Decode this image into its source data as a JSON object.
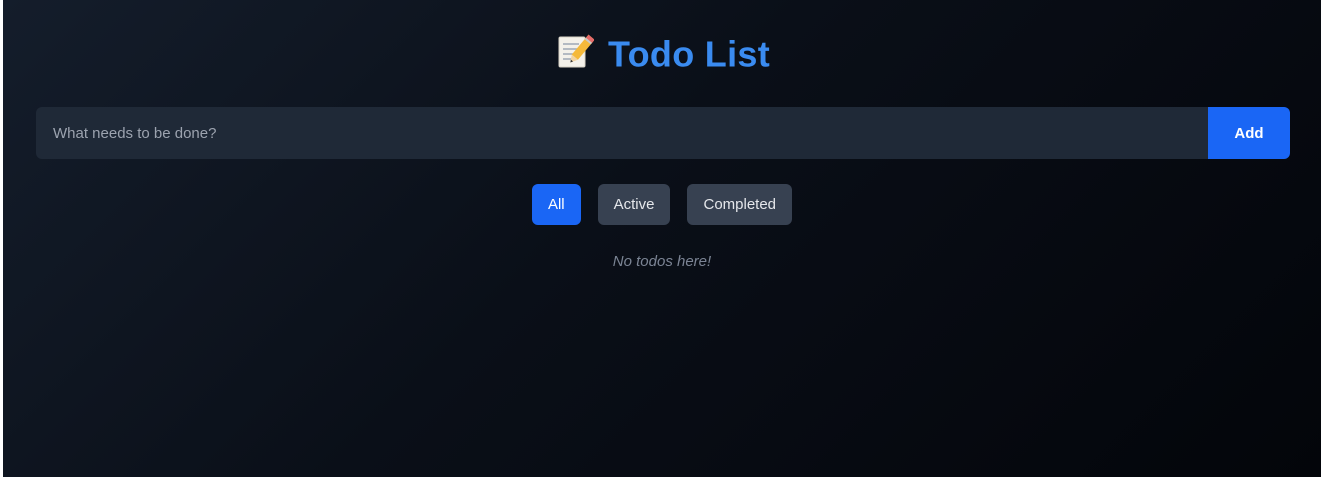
{
  "header": {
    "title": "Todo List",
    "icon": "memo-icon",
    "title_color": "#3a8bf0"
  },
  "new_todo": {
    "value": "",
    "placeholder": "What needs to be done?",
    "add_label": "Add"
  },
  "filters": {
    "items": [
      {
        "label": "All",
        "selected": true
      },
      {
        "label": "Active",
        "selected": false
      },
      {
        "label": "Completed",
        "selected": false
      }
    ]
  },
  "list": {
    "empty_message": "No todos here!"
  },
  "colors": {
    "accent": "#1a66f5",
    "input_bg": "#1f2937",
    "filter_bg": "#374151"
  }
}
